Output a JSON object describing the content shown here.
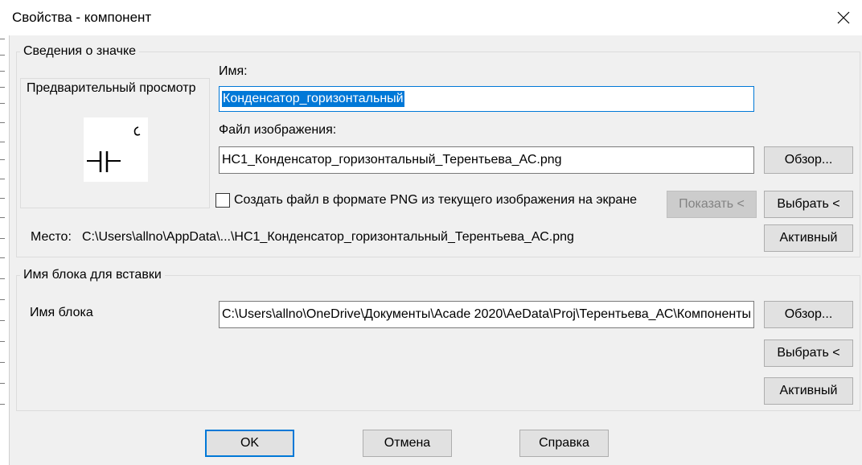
{
  "window": {
    "title": "Свойства - компонент",
    "close_icon": "close-icon"
  },
  "icon_group": {
    "legend": "Сведения о значке",
    "preview_label": "Предварительный просмотр",
    "name_label": "Имя:",
    "name_value": "Конденсатор_горизонтальный",
    "image_file_label": "Файл изображения:",
    "image_file_value": "НС1_Конденсатор_горизонтальный_Терентьева_АС.png",
    "browse_label": "Обзор...",
    "checkbox_label": "Создать файл в формате PNG из текущего изображения на экране",
    "checkbox_checked": false,
    "show_label": "Показать <",
    "pick_label": "Выбрать <",
    "location_label": "Место:",
    "location_value": "C:\\Users\\allno\\AppData\\...\\НС1_Конденсатор_горизонтальный_Терентьева_АС.png",
    "active_label": "Активный"
  },
  "block_group": {
    "legend": "Имя блока для вставки",
    "block_name_label": "Имя блока",
    "block_name_value": "C:\\Users\\allno\\OneDrive\\Документы\\Acade 2020\\AeData\\Proj\\Терентьева_АС\\Компоненты",
    "browse_label": "Обзор...",
    "pick_label": "Выбрать <",
    "active_label": "Активный"
  },
  "footer": {
    "ok_label": "OK",
    "cancel_label": "Отмена",
    "help_label": "Справка"
  },
  "colors": {
    "dialog_bg": "#f0f0f0",
    "accent": "#0078d7",
    "button_bg": "#e1e1e1",
    "disabled_button_bg": "#cccccc"
  }
}
